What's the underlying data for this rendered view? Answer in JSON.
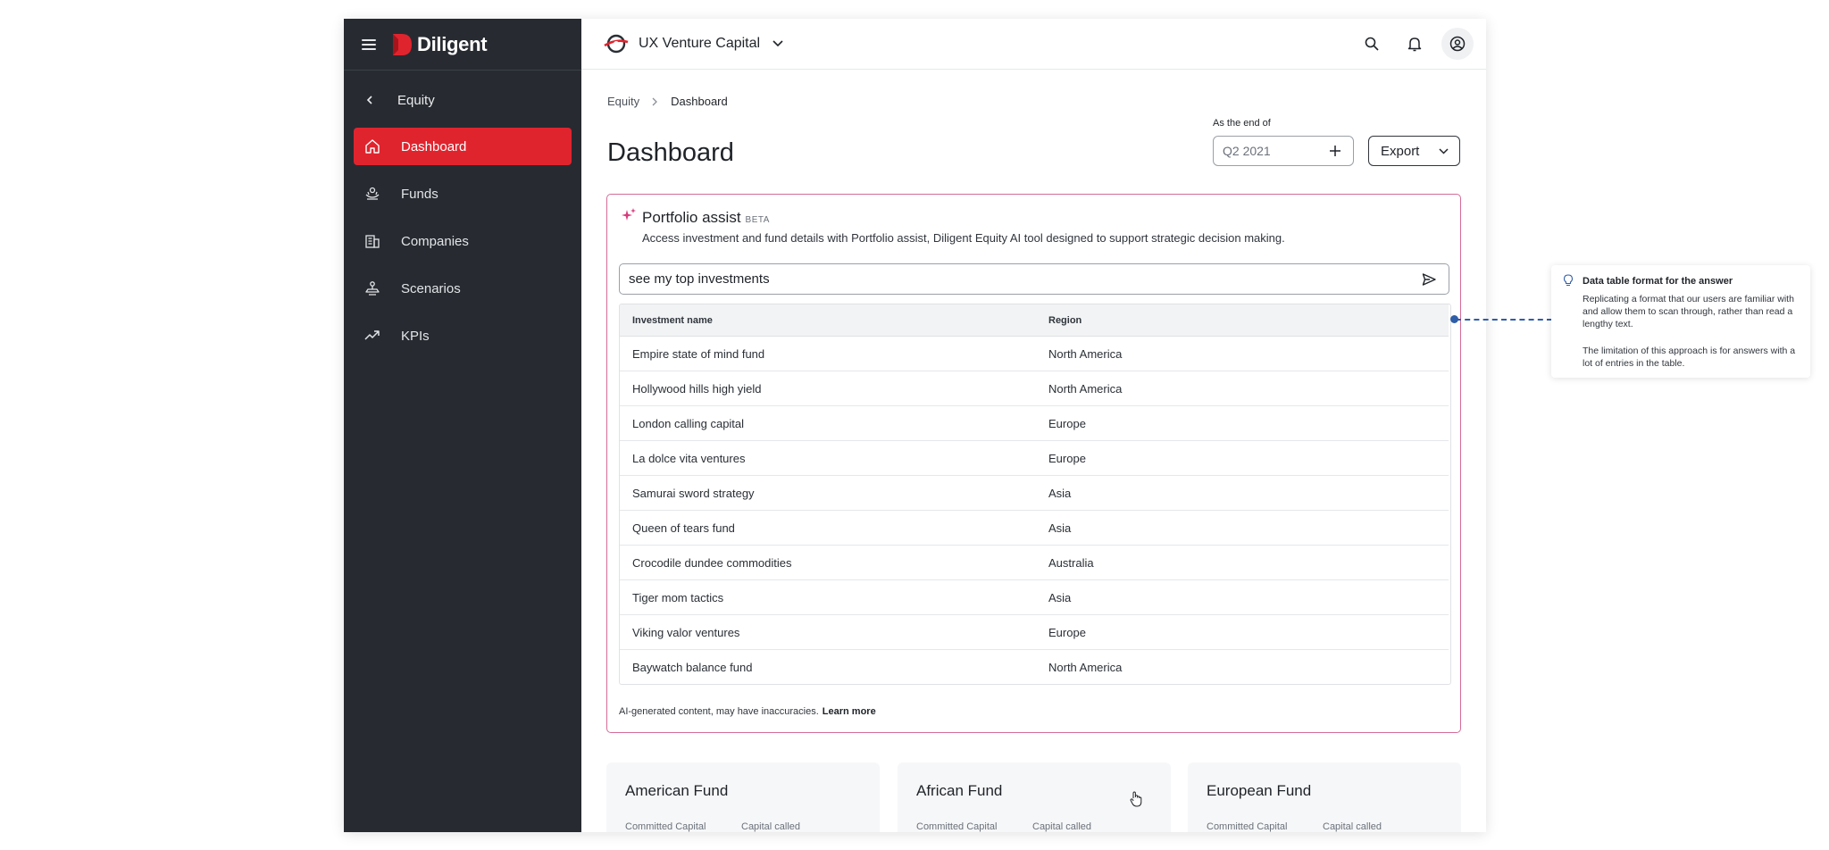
{
  "brand": {
    "name": "Diligent",
    "accent": "#e0242e",
    "sidebar_bg": "#272b31"
  },
  "topbar": {
    "org_name": "UX Venture Capital"
  },
  "sidebar": {
    "back_label": "Equity",
    "items": [
      {
        "label": "Dashboard",
        "icon": "home-icon",
        "active": true
      },
      {
        "label": "Funds",
        "icon": "funds-icon",
        "active": false
      },
      {
        "label": "Companies",
        "icon": "building-icon",
        "active": false
      },
      {
        "label": "Scenarios",
        "icon": "scenario-icon",
        "active": false
      },
      {
        "label": "KPIs",
        "icon": "trend-icon",
        "active": false
      }
    ]
  },
  "breadcrumb": {
    "parent": "Equity",
    "current": "Dashboard"
  },
  "page": {
    "title": "Dashboard",
    "asof_label": "As the end of",
    "asof_placeholder": "Q2 2021",
    "export_label": "Export"
  },
  "assist": {
    "title": "Portfolio assist",
    "badge": "BETA",
    "description": "Access investment and fund details with Portfolio assist, Diligent Equity AI tool designed to support strategic decision making.",
    "prompt_value": "see my top investments",
    "columns": [
      "Investment name",
      "Region"
    ],
    "rows": [
      [
        "Empire state of mind fund",
        "North America"
      ],
      [
        "Hollywood hills high yield",
        "North America"
      ],
      [
        "London calling capital",
        "Europe"
      ],
      [
        "La dolce vita ventures",
        "Europe"
      ],
      [
        "Samurai sword strategy",
        "Asia"
      ],
      [
        "Queen of tears fund",
        "Asia"
      ],
      [
        "Crocodile dundee commodities",
        "Australia"
      ],
      [
        "Tiger mom tactics",
        "Asia"
      ],
      [
        "Viking valor ventures",
        "Europe"
      ],
      [
        "Baywatch balance fund",
        "North America"
      ]
    ],
    "disclaimer": "AI-generated content, may have inaccuracies.",
    "learn_more": "Learn more"
  },
  "funds": [
    {
      "name": "American Fund",
      "m1": "Committed Capital",
      "m2": "Capital called"
    },
    {
      "name": "African Fund",
      "m1": "Committed Capital",
      "m2": "Capital called"
    },
    {
      "name": "European Fund",
      "m1": "Committed Capital",
      "m2": "Capital called"
    }
  ],
  "annotation": {
    "title": "Data table format for the answer",
    "p1": "Replicating a format that our users are familiar with and allow them to scan through, rather than read a lengthy text.",
    "p2": "The limitation of this approach is for answers with a lot of entries in the table."
  }
}
